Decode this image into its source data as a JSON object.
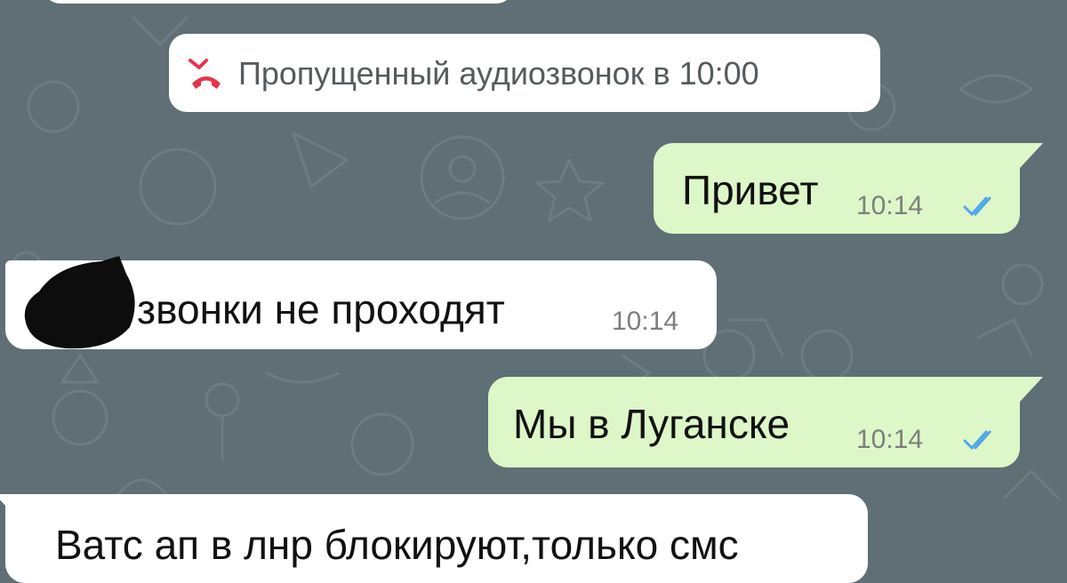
{
  "colors": {
    "background": "#5f6f75",
    "incoming_bubble": "#ffffff",
    "outgoing_bubble": "#ddf7c8",
    "missed_call_red": "#e8334c",
    "read_ticks": "#4fa7e8",
    "timestamp_gray": "#7b7f7d"
  },
  "system_message": {
    "icon": "missed-call-icon",
    "text": "Пропущенный аудиозвонок в 10:00"
  },
  "messages": [
    {
      "direction": "outgoing",
      "text": "Привет",
      "time": "10:14",
      "status": "read"
    },
    {
      "direction": "incoming",
      "text": "звонки не проходят",
      "time": "10:14",
      "sender_redacted": true
    },
    {
      "direction": "outgoing",
      "text": "Мы в Луганске",
      "time": "10:14",
      "status": "read"
    },
    {
      "direction": "incoming",
      "text": "Ватс ап в лнр блокируют,только смс",
      "time": ""
    }
  ]
}
